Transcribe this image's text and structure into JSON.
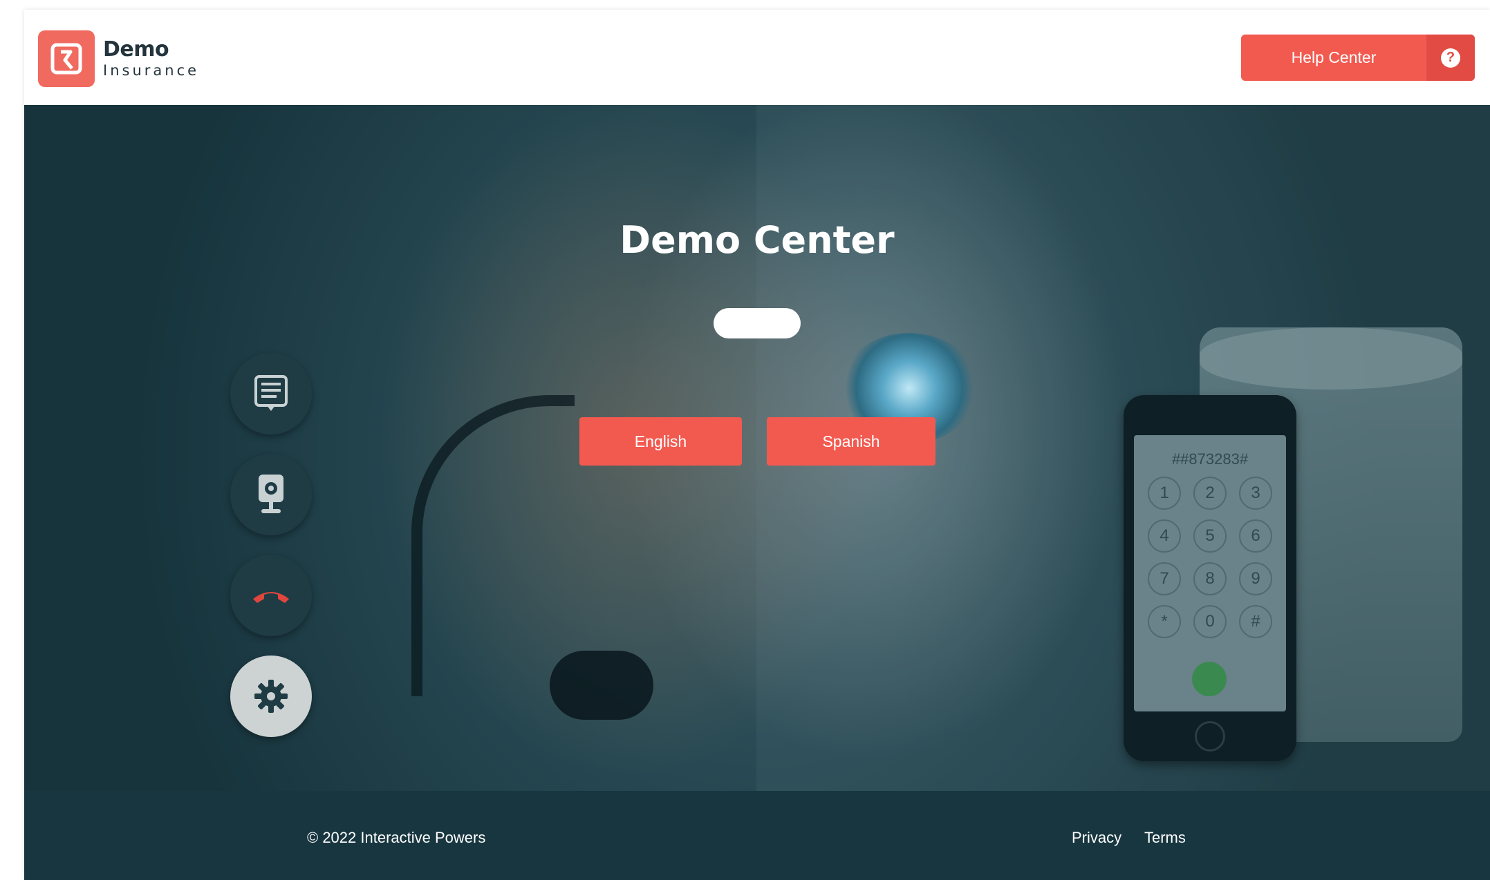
{
  "header": {
    "brand_name": "Demo",
    "brand_sub": "Insurance",
    "help_button_label": "Help Center",
    "help_icon": "?"
  },
  "hero": {
    "title": "Demo Center",
    "language_buttons": [
      "English",
      "Spanish"
    ],
    "side_buttons": [
      {
        "icon": "chat-icon"
      },
      {
        "icon": "webcam-icon"
      },
      {
        "icon": "hangup-phone-icon"
      },
      {
        "icon": "gear-icon"
      }
    ],
    "phone_display": "##873283#",
    "phone_keys": [
      "1",
      "2",
      "3",
      "4",
      "5",
      "6",
      "7",
      "8",
      "9",
      "*",
      "0",
      "#"
    ]
  },
  "footer": {
    "copyright": "© 2022 Interactive Powers",
    "links": [
      "Privacy",
      "Terms"
    ]
  },
  "colors": {
    "accent": "#f25a50",
    "dark": "#183640",
    "hero": "#254650"
  }
}
